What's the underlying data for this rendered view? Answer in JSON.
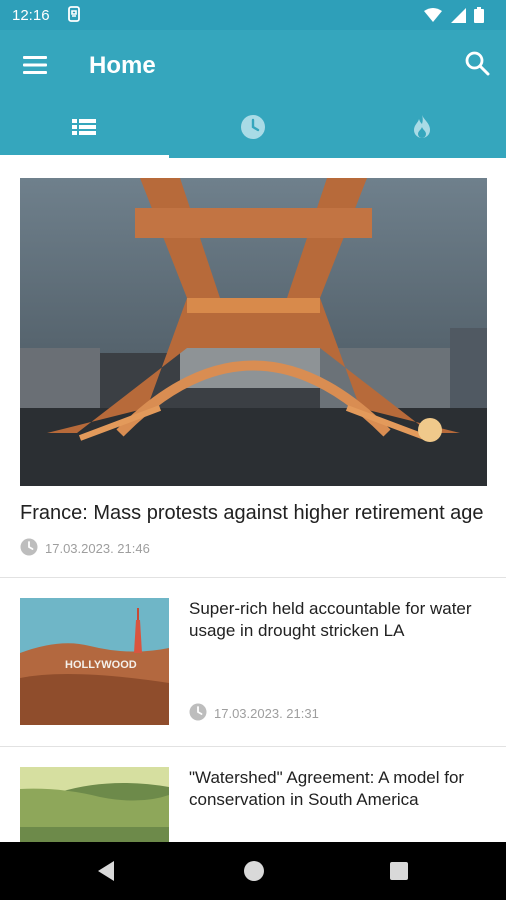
{
  "status_bar": {
    "time": "12:16",
    "notification_icon": "sim-card-icon",
    "indicators": [
      "wifi-icon",
      "signal-icon",
      "battery-icon"
    ]
  },
  "app_bar": {
    "title": "Home",
    "menu_icon": "menu-icon",
    "search_icon": "search-icon"
  },
  "tabs": [
    {
      "name": "list-icon",
      "selected": true
    },
    {
      "name": "clock-icon",
      "selected": false
    },
    {
      "name": "flame-icon",
      "selected": false
    }
  ],
  "articles": [
    {
      "title": "France: Mass protests against higher retirement age",
      "date": "17.03.2023. 21:46",
      "image": "eiffel-tower-photo"
    },
    {
      "title": "Super-rich held accountable for water usage in drought stricken LA",
      "date": "17.03.2023. 21:31",
      "image": "hollywood-sign-photo"
    },
    {
      "title": "\"Watershed\" Agreement: A model for conservation in South America",
      "date": "",
      "image": "forest-hills-photo"
    }
  ],
  "colors": {
    "primary": "#35a6bd",
    "status_bar": "#2e9fb9"
  }
}
